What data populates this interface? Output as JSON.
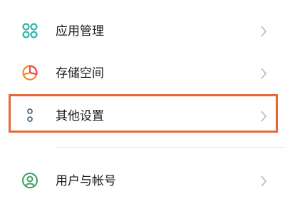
{
  "settings": {
    "items": [
      {
        "label": "应用管理",
        "icon": "app-grid-icon"
      },
      {
        "label": "存储空间",
        "icon": "storage-pie-icon"
      },
      {
        "label": "其他设置",
        "icon": "more-dots-icon"
      },
      {
        "label": "用户与帐号",
        "icon": "user-account-icon"
      }
    ],
    "highlighted_item": "其他设置"
  },
  "colors": {
    "teal_icon": "#2bb5a5",
    "storage_icon_orange": "#f08a24",
    "storage_icon_red": "#e8484a",
    "dots_icon": "#4a6a85",
    "account_icon": "#3fa05a",
    "highlight_border": "#e46a35",
    "chevron": "#b8b8b8"
  }
}
